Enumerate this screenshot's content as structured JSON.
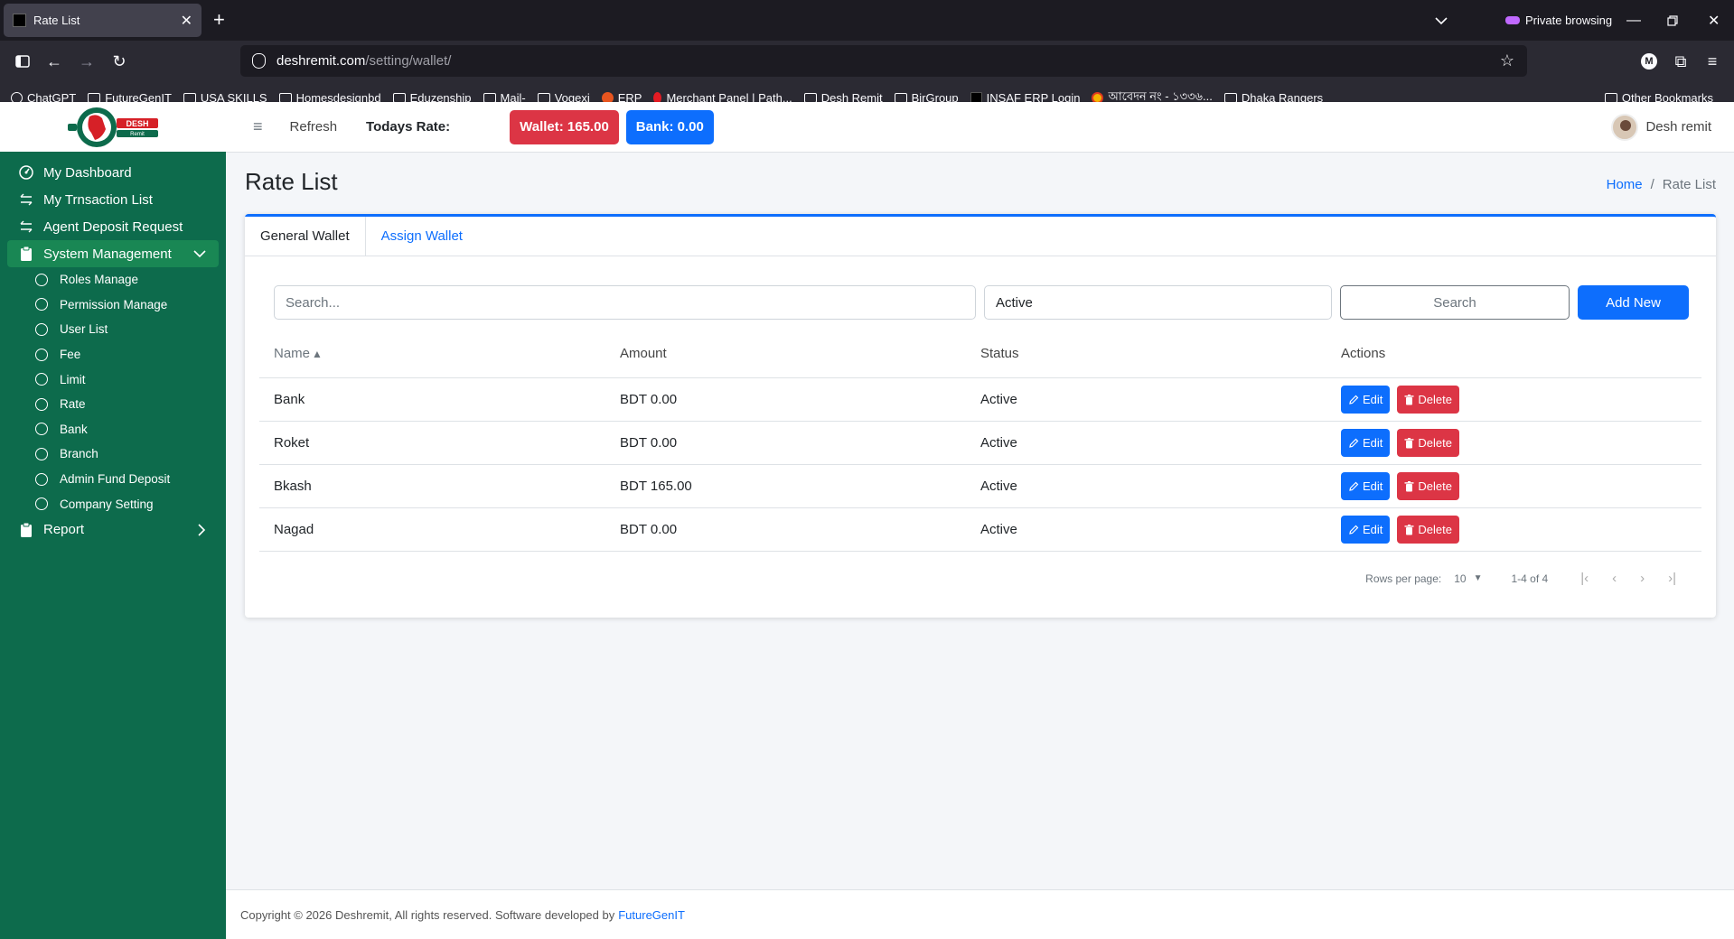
{
  "browser": {
    "tab_title": "Rate List",
    "private_label": "Private browsing",
    "url_host": "deshremit.com",
    "url_path": "/setting/wallet/",
    "bookmarks": [
      {
        "label": "ChatGPT",
        "icon": "chatgpt-icon"
      },
      {
        "label": "FutureGenIT",
        "icon": "folder-icon"
      },
      {
        "label": "USA SKILLS",
        "icon": "folder-icon"
      },
      {
        "label": "Homesdesignbd",
        "icon": "folder-icon"
      },
      {
        "label": "Eduzenship",
        "icon": "folder-icon"
      },
      {
        "label": "Mail-",
        "icon": "folder-icon"
      },
      {
        "label": "Vogexi",
        "icon": "folder-icon"
      },
      {
        "label": "ERP",
        "icon": "erp-icon"
      },
      {
        "label": "Merchant Panel | Path...",
        "icon": "pathao-icon"
      },
      {
        "label": "Desh Remit",
        "icon": "folder-icon"
      },
      {
        "label": "BirGroup",
        "icon": "folder-icon"
      },
      {
        "label": "INSAF ERP Login",
        "icon": "insaf-icon"
      },
      {
        "label": "আবেদন নং - ১৩৩৬...",
        "icon": "gov-icon"
      },
      {
        "label": "Dhaka Rangers",
        "icon": "folder-icon"
      }
    ],
    "other_bookmarks": "Other Bookmarks"
  },
  "sidebar": {
    "logo_text": "DESH Remit",
    "items": [
      {
        "label": "My Dashboard",
        "icon": "dashboard-icon"
      },
      {
        "label": "My Trnsaction List",
        "icon": "transfer-icon"
      },
      {
        "label": "Agent Deposit Request",
        "icon": "transfer-icon"
      },
      {
        "label": "System Management",
        "icon": "clipboard-icon"
      }
    ],
    "sub_items": [
      "Roles Manage",
      "Permission Manage",
      "User List",
      "Fee",
      "Limit",
      "Rate",
      "Bank",
      "Branch",
      "Admin Fund Deposit",
      "Company Setting"
    ],
    "report": {
      "label": "Report",
      "icon": "clipboard-icon"
    }
  },
  "topbar": {
    "refresh": "Refresh",
    "todays_rate": "Todays Rate:",
    "wallet": "Wallet: 165.00",
    "bank": "Bank: 0.00",
    "user_name": "Desh remit"
  },
  "page": {
    "title": "Rate List",
    "breadcrumb_home": "Home",
    "breadcrumb_sep": "/",
    "breadcrumb_current": "Rate List"
  },
  "tabs": [
    "General Wallet",
    "Assign Wallet"
  ],
  "filters": {
    "search_placeholder": "Search...",
    "status_value": "Active",
    "search_button": "Search",
    "add_button": "Add New"
  },
  "table": {
    "headers": [
      "Name",
      "Amount",
      "Status",
      "Actions"
    ],
    "sort_indicator": "▲",
    "rows": [
      {
        "name": "Bank",
        "amount": "BDT 0.00",
        "status": "Active"
      },
      {
        "name": "Roket",
        "amount": "BDT 0.00",
        "status": "Active"
      },
      {
        "name": "Bkash",
        "amount": "BDT 165.00",
        "status": "Active"
      },
      {
        "name": "Nagad",
        "amount": "BDT 0.00",
        "status": "Active"
      }
    ],
    "edit_label": "Edit",
    "delete_label": "Delete"
  },
  "pagination": {
    "rows_per_page_label": "Rows per page:",
    "rows_per_page_value": "10",
    "range": "1-4 of 4"
  },
  "footer": {
    "text": "Copyright © 2026 Deshremit, All rights reserved. Software developed by",
    "link": "FutureGenIT"
  },
  "colors": {
    "sidebar_bg": "#0d6b4c",
    "primary": "#0d6efd",
    "danger": "#dc3545"
  }
}
